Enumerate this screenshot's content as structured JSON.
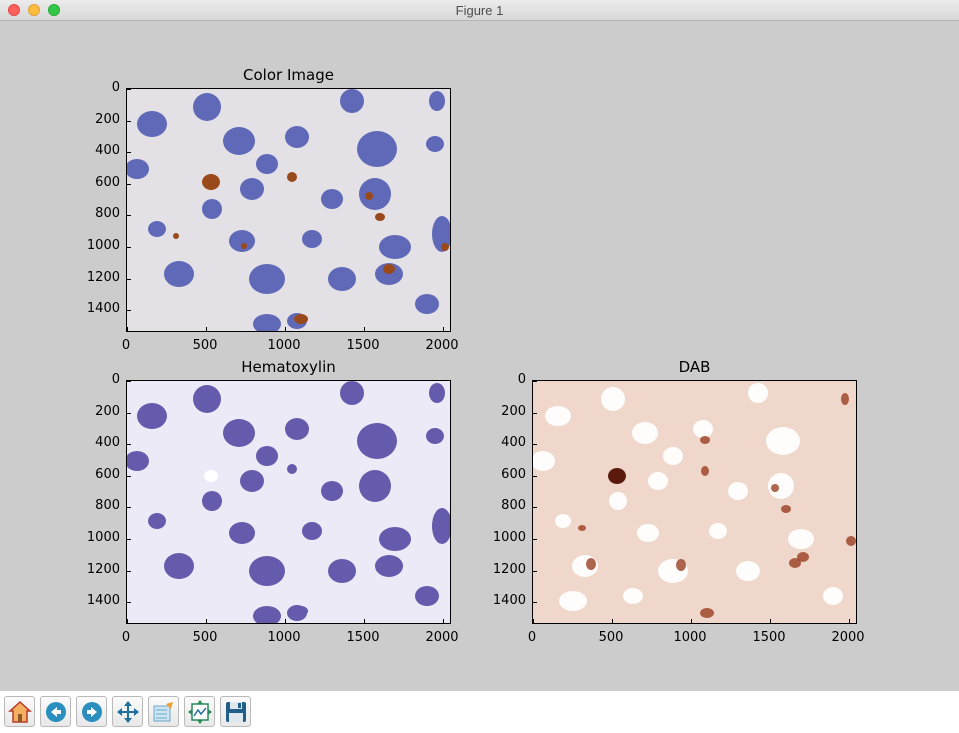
{
  "window": {
    "title": "Figure 1"
  },
  "panels": [
    {
      "title": "Color Image",
      "yticks": [
        "0",
        "200",
        "400",
        "600",
        "800",
        "1000",
        "1200",
        "1400"
      ],
      "xticks": [
        "0",
        "500",
        "1000",
        "1500",
        "2000"
      ],
      "bg": "#e6e2dc",
      "blob": "#4a56b4",
      "accent": "#9a4a1a"
    },
    {
      "title": "Hematoxylin",
      "yticks": [
        "0",
        "200",
        "400",
        "600",
        "800",
        "1000",
        "1200",
        "1400"
      ],
      "xticks": [
        "0",
        "500",
        "1000",
        "1500",
        "2000"
      ],
      "bg": "#eeeefa",
      "blob": "#4e45a0",
      "accent": "#4e45a0"
    },
    {
      "title": "DAB",
      "yticks": [
        "0",
        "200",
        "400",
        "600",
        "800",
        "1000",
        "1200",
        "1400"
      ],
      "xticks": [
        "0",
        "500",
        "1000",
        "1500",
        "2000"
      ],
      "bg": "#efd6c9",
      "blob": "#ffffff",
      "accent": "#9a3f22"
    }
  ],
  "toolbar": {
    "buttons": [
      {
        "icon": "home-icon",
        "name": "home-button"
      },
      {
        "icon": "back-arrow-icon",
        "name": "back-button"
      },
      {
        "icon": "forward-arrow-icon",
        "name": "forward-button"
      },
      {
        "icon": "pan-move-icon",
        "name": "pan-button"
      },
      {
        "icon": "zoom-rect-icon",
        "name": "zoom-button"
      },
      {
        "icon": "subplots-configure-icon",
        "name": "subplots-button"
      },
      {
        "icon": "save-floppy-icon",
        "name": "save-button"
      }
    ]
  }
}
